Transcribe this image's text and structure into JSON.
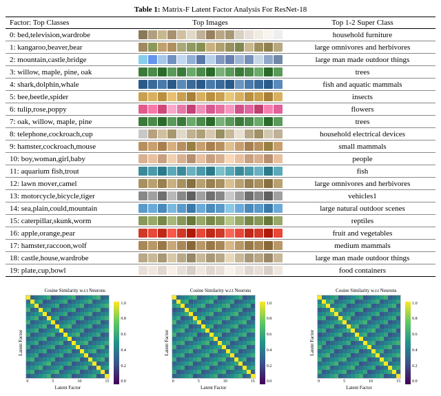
{
  "table": {
    "caption_label": "Table 1:",
    "caption_text": "Matrix-F Latent Factor Analysis For ResNet-18",
    "headers": {
      "factor": "Factor: Top Classes",
      "images": "Top Images",
      "super": "Top 1-2 Super Class"
    },
    "rows": [
      {
        "factor": "0: bed,television,wardrobe",
        "super": "household furniture"
      },
      {
        "factor": "1: kangaroo,beaver,bear",
        "super": "large omnivores and herbivores"
      },
      {
        "factor": "2: mountain,castle,bridge",
        "super": "large man made outdoor things"
      },
      {
        "factor": "3: willow, maple, pine, oak",
        "super": "trees"
      },
      {
        "factor": "4: shark,dolphin,whale",
        "super": "fish and aquatic mammals"
      },
      {
        "factor": "5: bee,beetle,spider",
        "super": "insects"
      },
      {
        "factor": "6: tulip,rose,poppy",
        "super": "flowers"
      },
      {
        "factor": "7: oak, willow, maple, pine",
        "super": "trees"
      },
      {
        "factor": "8: telephone,cockroach,cup",
        "super": "household electrical devices"
      },
      {
        "factor": "9: hamster,cockroach,mouse",
        "super": "small mammals"
      },
      {
        "factor": "10: boy,woman,girl,baby",
        "super": "people"
      },
      {
        "factor": "11: aquarium fish,trout",
        "super": "fish"
      },
      {
        "factor": "12: lawn mover,camel",
        "super": "large omnivores and herbivores"
      },
      {
        "factor": "13: motorcycle,bicycle,tiger",
        "super": "vehicles1"
      },
      {
        "factor": "14: sea,plain,could,mountain",
        "super": "large natural outdoor scenes"
      },
      {
        "factor": "15: caterpillar,skunk,worm",
        "super": "reptiles"
      },
      {
        "factor": "16: apple,orange,pear",
        "super": "fruit and vegetables"
      },
      {
        "factor": "17: hamster,raccoon,wolf",
        "super": "medium mammals"
      },
      {
        "factor": "18: castle,house,wardrobe",
        "super": "large man made outdoor things"
      },
      {
        "factor": "19: plate,cup,bowl",
        "super": "food containers"
      }
    ],
    "thumb_palettes": [
      [
        "#8a7a5a",
        "#b0a080",
        "#c8b890",
        "#a89070",
        "#d0c0a0",
        "#e0d8c8",
        "#c0b098",
        "#988060",
        "#b8a888",
        "#a89878",
        "#d8d0c0",
        "#e8e0d8",
        "#f0ece4",
        "#f8f4f0",
        "#eee"
      ],
      [
        "#a08860",
        "#8a9a5a",
        "#c0a070",
        "#b09060",
        "#a8a878",
        "#909a60",
        "#889050",
        "#c8b080",
        "#b0a070",
        "#989060",
        "#808850",
        "#c8b890",
        "#a09060",
        "#908050",
        "#b8a880"
      ],
      [
        "#87ceeb",
        "#6495ed",
        "#a8c8e8",
        "#7090c0",
        "#c0d8f0",
        "#90b0d8",
        "#5878a8",
        "#b8d0e8",
        "#8098c0",
        "#6880b0",
        "#a0b8d8",
        "#7890b8",
        "#c8d8e8",
        "#90a8c8",
        "#7088a8"
      ],
      [
        "#3a7a3a",
        "#4a8a4a",
        "#2a6a2a",
        "#5a9a5a",
        "#3a7a3a",
        "#6aaa6a",
        "#4a8a4a",
        "#2a6a2a",
        "#7ab07a",
        "#5a9a5a",
        "#3a7a3a",
        "#4a8a4a",
        "#6aaa6a",
        "#2a6a2a",
        "#5a9a5a"
      ],
      [
        "#2a5a8a",
        "#3a6a9a",
        "#4a7aaa",
        "#2a5a8a",
        "#5a8aba",
        "#3a6a9a",
        "#2a5a8a",
        "#4a7aaa",
        "#3a6a9a",
        "#2a5a8a",
        "#6a95c0",
        "#4a7aaa",
        "#3a6a9a",
        "#2a5a8a",
        "#5a8aba"
      ],
      [
        "#c8a050",
        "#d8b060",
        "#b89040",
        "#e8c070",
        "#c8a050",
        "#a88038",
        "#d8b060",
        "#b89040",
        "#c8a050",
        "#e8c878",
        "#d8b060",
        "#b89040",
        "#c8a050",
        "#a88038",
        "#d8b060"
      ],
      [
        "#e05a8a",
        "#f878a8",
        "#d04878",
        "#f8a8c8",
        "#e878a8",
        "#c84078",
        "#f090b8",
        "#d85890",
        "#e870a0",
        "#f898c0",
        "#d05088",
        "#e068a0",
        "#c04070",
        "#f880b0",
        "#e06098"
      ],
      [
        "#3a7a3a",
        "#4a8a4a",
        "#2a6a2a",
        "#5a9a5a",
        "#3a7a3a",
        "#6aaa6a",
        "#4a8a4a",
        "#2a6a2a",
        "#7ab07a",
        "#5a9a5a",
        "#3a7a3a",
        "#4a8a4a",
        "#6aaa6a",
        "#2a6a2a",
        "#5a9a5a"
      ],
      [
        "#c8c8c8",
        "#b8a080",
        "#d0c0a0",
        "#a89870",
        "#e0d8c8",
        "#c0b090",
        "#b0a078",
        "#d8c8b0",
        "#989060",
        "#c8b898",
        "#e8e0d0",
        "#b8a888",
        "#a09068",
        "#d0c8b0",
        "#c0b098"
      ],
      [
        "#b89060",
        "#c8a070",
        "#a88050",
        "#d8b080",
        "#b89060",
        "#988040",
        "#c8a070",
        "#a88050",
        "#b89060",
        "#e0c090",
        "#c8a070",
        "#a88050",
        "#b89060",
        "#988040",
        "#c8a070"
      ],
      [
        "#d8b090",
        "#e8c0a0",
        "#c8a080",
        "#f0d0b0",
        "#d8b090",
        "#b89070",
        "#e8c0a0",
        "#c8a080",
        "#d8b090",
        "#f8d8b8",
        "#e8c0a0",
        "#c8a080",
        "#d8b090",
        "#b89070",
        "#e8c0a0"
      ],
      [
        "#3a8a9a",
        "#4a9aaa",
        "#2a7a8a",
        "#5aaaba",
        "#3a8a9a",
        "#6ab0c0",
        "#4a9aaa",
        "#2a7a8a",
        "#7ac0ca",
        "#5aaaba",
        "#3a8a9a",
        "#4a9aaa",
        "#6ab0c0",
        "#2a7a8a",
        "#5aaaba"
      ],
      [
        "#a89060",
        "#b8a070",
        "#988050",
        "#c8b080",
        "#a89060",
        "#887040",
        "#b8a070",
        "#988050",
        "#a89060",
        "#d8c090",
        "#b8a070",
        "#988050",
        "#a89060",
        "#887040",
        "#b8a070"
      ],
      [
        "#888888",
        "#a0a0a0",
        "#707070",
        "#b8b8b8",
        "#888888",
        "#606060",
        "#a0a0a0",
        "#707070",
        "#888888",
        "#c8c8c8",
        "#a0a0a0",
        "#707070",
        "#888888",
        "#606060",
        "#a0a0a0"
      ],
      [
        "#5a9aca",
        "#6aaad8",
        "#4a8aba",
        "#7ab8e0",
        "#5a9aca",
        "#3a7aaa",
        "#6aaad8",
        "#4a8aba",
        "#5a9aca",
        "#8ac8e8",
        "#6aaad8",
        "#4a8aba",
        "#5a9aca",
        "#3a7aaa",
        "#6aaad8"
      ],
      [
        "#889858",
        "#98a868",
        "#788848",
        "#a8b878",
        "#889858",
        "#687838",
        "#98a868",
        "#788848",
        "#889858",
        "#b8c888",
        "#98a868",
        "#788848",
        "#889858",
        "#687838",
        "#98a868"
      ],
      [
        "#d03828",
        "#e84838",
        "#c02818",
        "#f85848",
        "#d03828",
        "#b01808",
        "#e84838",
        "#c02818",
        "#d03828",
        "#f86858",
        "#e84838",
        "#c02818",
        "#d03828",
        "#b01808",
        "#e84838"
      ],
      [
        "#a88858",
        "#b89868",
        "#987848",
        "#c8a878",
        "#a88858",
        "#886838",
        "#b89868",
        "#987848",
        "#a88858",
        "#d8b888",
        "#b89868",
        "#987848",
        "#a88858",
        "#886838",
        "#b89868"
      ],
      [
        "#b8a888",
        "#c8b898",
        "#a89878",
        "#d8c8a8",
        "#b8a888",
        "#988868",
        "#c8b898",
        "#a89878",
        "#b8a888",
        "#e8d8b8",
        "#c8b898",
        "#a89878",
        "#b8a888",
        "#988868",
        "#c8b898"
      ],
      [
        "#e8e0d8",
        "#f0e8e0",
        "#e0d8d0",
        "#f8f0e8",
        "#e8e0d8",
        "#d8d0c8",
        "#f0e8e0",
        "#e0d8d0",
        "#e8e0d8",
        "#f8f4ec",
        "#f0e8e0",
        "#e0d8d0",
        "#e8e0d8",
        "#d8d0c8",
        "#f0e8e0"
      ]
    ]
  },
  "charts": {
    "title": "Cosine Similarity w.r.t Neurons",
    "xlabel": "Latent Factor",
    "ylabel": "Latent Factor",
    "xticks": [
      "0",
      "5",
      "10",
      "15"
    ],
    "cbar_ticks": [
      "1.0",
      "0.8",
      "0.6",
      "0.4",
      "0.2",
      "0.0"
    ]
  },
  "chart_data": [
    {
      "type": "heatmap",
      "title": "Cosine Similarity w.r.t Neurons",
      "xlabel": "Latent Factor",
      "ylabel": "Latent Factor",
      "xlim": [
        0,
        19
      ],
      "ylim": [
        0,
        19
      ],
      "colorscale": "viridis",
      "vmin": 0.0,
      "vmax": 1.0,
      "note": "20x20 identity-like matrix; diagonal ≈ 1.0, off-diagonal mostly 0.3–0.6"
    },
    {
      "type": "heatmap",
      "title": "Cosine Similarity w.r.t Neurons",
      "xlabel": "Latent Factor",
      "ylabel": "Latent Factor",
      "xlim": [
        0,
        19
      ],
      "ylim": [
        0,
        19
      ],
      "colorscale": "viridis",
      "vmin": 0.0,
      "vmax": 1.0,
      "note": "20x20 identity-like matrix; diagonal ≈ 1.0, off-diagonal mostly 0.3–0.6"
    },
    {
      "type": "heatmap",
      "title": "Cosine Similarity w.r.t Neurons",
      "xlabel": "Latent Factor",
      "ylabel": "Latent Factor",
      "xlim": [
        0,
        19
      ],
      "ylim": [
        0,
        19
      ],
      "colorscale": "viridis",
      "vmin": 0.0,
      "vmax": 1.0,
      "note": "20x20 identity-like matrix; diagonal ≈ 1.0, off-diagonal mostly 0.3–0.6"
    }
  ]
}
